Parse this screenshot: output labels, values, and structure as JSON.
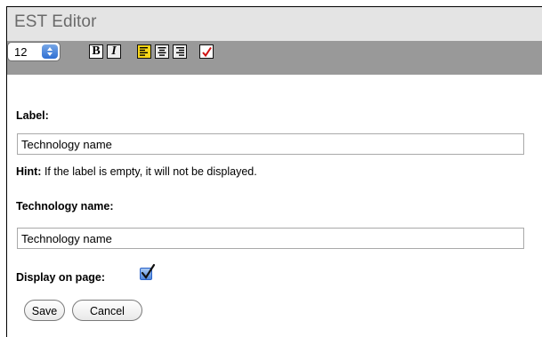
{
  "window": {
    "title": "EST Editor"
  },
  "toolbar": {
    "font_size": "12",
    "bold_label": "B",
    "italic_label": "I",
    "icons": [
      "bold-icon",
      "italic-icon",
      "align-left-icon",
      "align-center-icon",
      "align-right-icon",
      "spellcheck-icon"
    ],
    "highlight_color": "#f7d617",
    "check_color": "#d01010"
  },
  "form": {
    "label_heading": "Label:",
    "label_value": "Technology name",
    "hint_prefix": "Hint:",
    "hint_text": " If the label is empty, it will not be displayed.",
    "name_heading": "Technology name:",
    "name_value": "Technology name",
    "display_label": "Display on page:",
    "display_checked": true
  },
  "buttons": {
    "save": "Save",
    "cancel": "Cancel"
  }
}
